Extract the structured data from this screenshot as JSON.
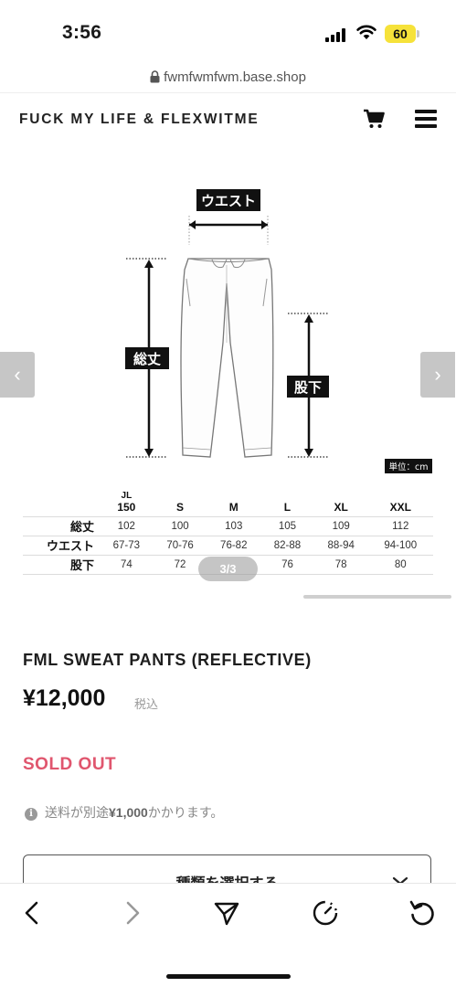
{
  "status_bar": {
    "time": "3:56",
    "battery": "60"
  },
  "browser": {
    "url": "fwmfwmfwm.base.shop"
  },
  "header": {
    "site_title": "FUCK MY LIFE & FLEXWITME",
    "icons": [
      "cart-icon",
      "menu-icon"
    ]
  },
  "diagram": {
    "labels": {
      "waist": "ウエスト",
      "total_length": "総丈",
      "inseam": "股下",
      "unit": "単位：cm"
    }
  },
  "size_table": {
    "header_jl_top": "JL",
    "columns": [
      "150",
      "S",
      "M",
      "L",
      "XL",
      "XXL"
    ],
    "rows": [
      {
        "label": "総丈",
        "values": [
          "102",
          "100",
          "103",
          "105",
          "109",
          "112"
        ]
      },
      {
        "label": "ウエスト",
        "values": [
          "67-73",
          "70-76",
          "76-82",
          "82-88",
          "88-94",
          "94-100"
        ]
      },
      {
        "label": "股下",
        "values": [
          "74",
          "72",
          "",
          "76",
          "78",
          "80"
        ]
      }
    ]
  },
  "carousel": {
    "page_indicator": "3/3",
    "prev_symbol": "‹",
    "next_symbol": "›"
  },
  "product": {
    "name": "FML SWEAT PANTS (REFLECTIVE)",
    "price": "¥12,000",
    "tax_label": "税込",
    "status": "SOLD OUT",
    "shipping_prefix": "送料が別途",
    "shipping_amount": "¥1,000",
    "shipping_suffix": "かかります。",
    "select_label": "種類を選択する"
  },
  "colors": {
    "sold_out": "#e0566e",
    "battery": "#f6e23a"
  }
}
